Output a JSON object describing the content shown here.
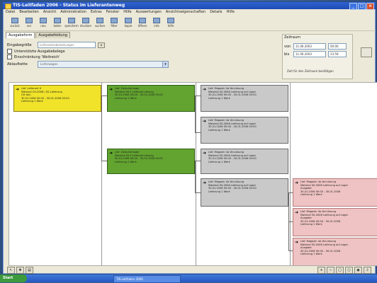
{
  "window": {
    "title": "TIS-Leitfaden 2006 - Status im Lieferantenweg",
    "controls": [
      "_",
      "□",
      "×"
    ]
  },
  "menu": [
    "Datei",
    "Bearbeiten",
    "Ansicht",
    "Administration",
    "Extras",
    "Fenster",
    "Hilfe",
    "Auswertungen",
    "Ansichtseigenschaften",
    "Details",
    "Hilfe"
  ],
  "toolbar": [
    "zurück",
    "vor",
    "neu",
    "laden",
    "speichern",
    "drucken",
    "suchen",
    "filter",
    "kopie",
    "öffnen",
    "info",
    "hilfe"
  ],
  "tabs": [
    "Ausgabeform",
    "Ausgabefeldung"
  ],
  "form": {
    "label1": "Eingabegröße",
    "input1": "Lieferantenbeziehungen",
    "check1": "Unterstützte Ausgabebelege",
    "check2": "Einschränkung 'Weitreich'",
    "label2": "Ablaufkette",
    "select1": "Lieferwagen"
  },
  "date_panel": {
    "title": "Zeitraum",
    "row1_label": "von",
    "row1_date": "11.06.2003",
    "row1_time": "00:00",
    "row2_label": "bis",
    "row2_date": "11.06.2003",
    "row2_time": "23:59",
    "button": "Zeit für den Zeitraum bestätigen"
  },
  "nodes": {
    "yellow": [
      "Lief.   Lieferant X",
      "Material  CH-0006 / SS-Lieferung",
      "Ort Abl.",
      "30.01.2006 00:00 - 30.01.2006 00:00",
      "Lieferung 1  Werk"
    ],
    "green1": [
      "Lief.   Zwischenlager",
      "Material  SS-Y Lieferant-Lösung",
      "30.01.2006 00:00 - 30.01.2006 00:00",
      "Lieferung 1  Werk"
    ],
    "green2": [
      "Lief.   Zwischenlager",
      "Material  SS-Y Lieferant-Lösung",
      "30.01.2006 00:00 - 30.01.2006 00:00",
      "Lieferung 1  Werk"
    ],
    "gray1": [
      "Lief.   Magazin 4a Ver-Lösung",
      "Material  SS-0006 Lieferung auf Lager",
      "30.01.2006 00:00 - 30.01.2006 00:00",
      "Lieferung 1  Werk"
    ],
    "gray2": [
      "Lief.   Magazin 4a Ver-Lösung",
      "Material  SS-0006 Lieferung auf Lager",
      "30.01.2006 00:00 - 30.01.2006 00:00",
      "Lieferung 1  Werk"
    ],
    "gray3": [
      "Lief.   Magazin 4a Ver-Lösung",
      "Material  SS-0006 Lieferung auf Lager",
      "30.01.2006 00:00 - 30.01.2006 00:00",
      "Lieferung 1  Werk"
    ],
    "gray4": [
      "Lief.   Magazin 4a Ver-Lösung",
      "Material  SS-0006 Lieferung auf Lager",
      "30.01.2006 00:00 - 30.01.2006 00:00",
      "Lieferung 1  Werk"
    ],
    "pink1": [
      "Lief.   Magazin 4a Ver-Lösung",
      "Material  SS-0006 Lieferung auf Lager",
      "Ausgabe",
      "30.01.2006 00:00 - 30.01.2006",
      "Lieferung 1  Werk"
    ],
    "pink2": [
      "Lief.   Magazin 4a Ver-Lösung",
      "Material  SS-0006 Lieferung auf Lager",
      "Ausgabe",
      "30.01.2006 00:00 - 30.01.2006",
      "Lieferung 1  Werk"
    ],
    "pink3": [
      "Lief.   Magazin 4a Ver-Lösung",
      "Material  SS-0006 Lieferung auf Lager",
      "Ausgabe",
      "30.01.2006 00:00 - 30.01.2006",
      "Lieferung 1  Werk"
    ]
  },
  "taskbar": {
    "start": "Start",
    "task": "TIS-Leitfaden 2006"
  },
  "colors": {
    "yellow": "#f0e32a",
    "green": "#62a42f",
    "gray": "#c9c9c9",
    "pink": "#efc3c3"
  }
}
